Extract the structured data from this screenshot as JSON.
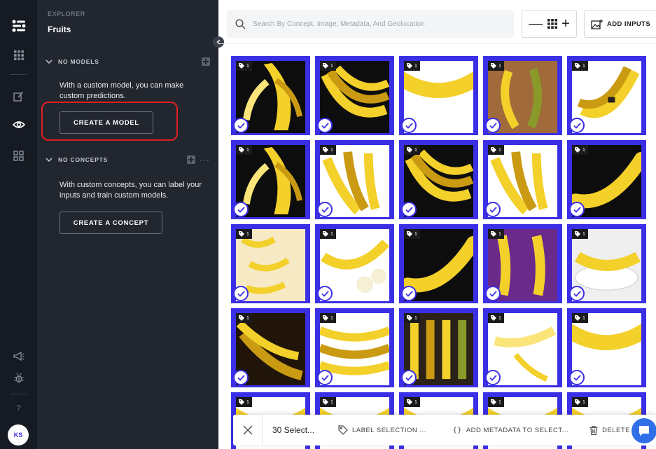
{
  "rail": {
    "avatar_initials": "KS",
    "help_label": "?"
  },
  "panel": {
    "explorer_label": "EXPLORER",
    "app_title": "Fruits",
    "models": {
      "title": "NO MODELS",
      "description": "With a custom model, you can make custom predictions.",
      "button_label": "CREATE A MODEL"
    },
    "concepts": {
      "title": "NO CONCEPTS",
      "description": "With custom concepts, you can label your inputs and train custom models.",
      "button_label": "CREATE A CONCEPT",
      "more": "···"
    }
  },
  "search": {
    "placeholder": "Search By Concept, Image, Metadata, And Geolocation"
  },
  "zoom": {
    "minus": "—",
    "plus": "+"
  },
  "add_inputs_label": "ADD INPUTS",
  "grid": {
    "tiles": [
      {
        "tag": "1",
        "scene": "peeled-dark"
      },
      {
        "tag": "1",
        "scene": "bunch-dark"
      },
      {
        "tag": "1",
        "scene": "single-white"
      },
      {
        "tag": "1",
        "scene": "wood-pair"
      },
      {
        "tag": "1",
        "scene": "sticker-white"
      },
      {
        "tag": "1",
        "scene": "peeled-dark"
      },
      {
        "tag": "1",
        "scene": "bunch-white"
      },
      {
        "tag": "1",
        "scene": "bunch-dark"
      },
      {
        "tag": "1",
        "scene": "bunch-white"
      },
      {
        "tag": "1",
        "scene": "single-dark"
      },
      {
        "tag": "1",
        "scene": "scatter-cream"
      },
      {
        "tag": "1",
        "scene": "sliced-white"
      },
      {
        "tag": "1",
        "scene": "single-dark"
      },
      {
        "tag": "1",
        "scene": "purple"
      },
      {
        "tag": "1",
        "scene": "plate"
      },
      {
        "tag": "1",
        "scene": "ripe-dark"
      },
      {
        "tag": "1",
        "scene": "stack-white"
      },
      {
        "tag": "1",
        "scene": "row-wood"
      },
      {
        "tag": "1",
        "scene": "peeled-white"
      },
      {
        "tag": "1",
        "scene": "single-white"
      },
      {
        "tag": "1",
        "scene": "single-white"
      },
      {
        "tag": "1",
        "scene": "single-white"
      },
      {
        "tag": "1",
        "scene": "single-white"
      },
      {
        "tag": "1",
        "scene": "single-white"
      },
      {
        "tag": "1",
        "scene": "single-white"
      }
    ]
  },
  "action_bar": {
    "selection_count": "30 Select...",
    "label_selection": "LABEL SELECTION ...",
    "add_metadata": "ADD METADATA TO SELECT...",
    "delete": "DELETE INP"
  },
  "colors": {
    "rail_bg": "#161a22",
    "panel_bg": "#22262f",
    "accent": "#3b2fe6",
    "highlight": "#e02020",
    "chat": "#2f6fe8"
  }
}
